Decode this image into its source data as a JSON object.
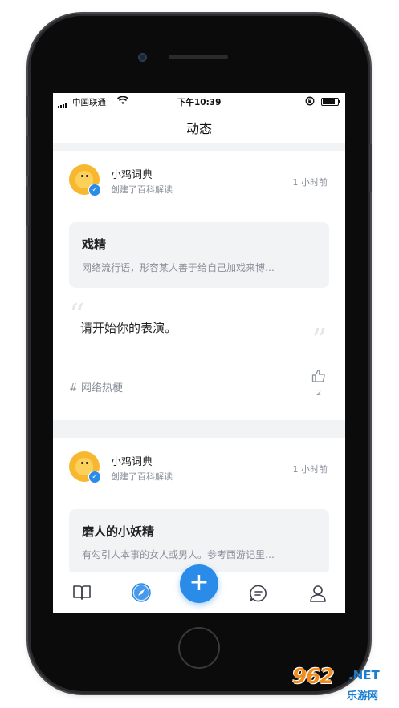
{
  "status_bar": {
    "carrier": "中国联通",
    "time": "下午10:39"
  },
  "navbar": {
    "title": "动态"
  },
  "posts": [
    {
      "username": "小鸡词典",
      "action": "创建了百科解读",
      "time": "1 小时前",
      "entry_word": "戏精",
      "entry_definition": "网络流行语，形容某人善于给自己加戏来博…",
      "quote": "请开始你的表演。",
      "tag": "# 网络热梗",
      "like_count": "2"
    },
    {
      "username": "小鸡词典",
      "action": "创建了百科解读",
      "time": "1 小时前",
      "entry_word": "磨人的小妖精",
      "entry_definition": "有勾引人本事的女人或男人。参考西游记里…"
    }
  ],
  "tabbar": {
    "items": [
      "book-icon",
      "compass-icon",
      "plus-icon",
      "chat-icon",
      "user-icon"
    ],
    "fab_label": "+"
  },
  "watermark": {
    "brand": "962",
    "suffix": ".NET",
    "sub": "乐游网"
  },
  "colors": {
    "accent": "#2b8be8",
    "avatar": "#f7b72e",
    "background": "#f2f3f5"
  }
}
